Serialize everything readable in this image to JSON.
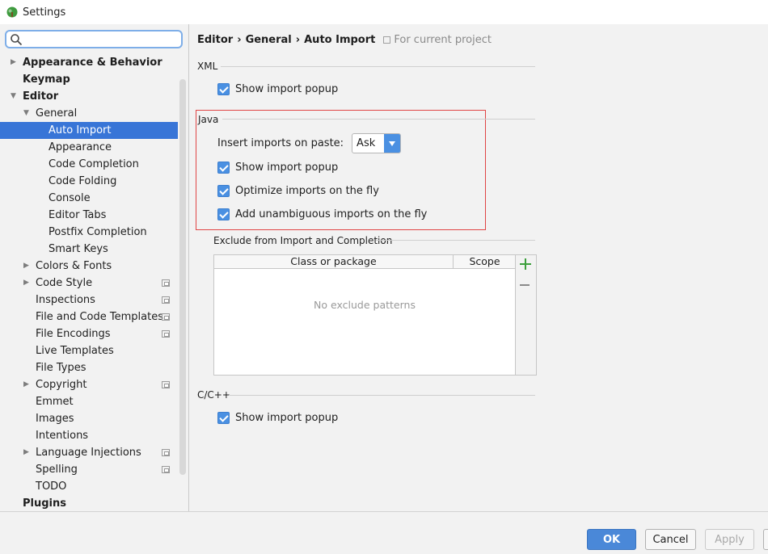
{
  "window": {
    "title": "Settings"
  },
  "search": {
    "placeholder": "",
    "value": ""
  },
  "sidebar": {
    "items": [
      {
        "label": "Appearance & Behavior",
        "level": 0,
        "arrow": "collapsed",
        "bold": true,
        "project": false,
        "selected": false
      },
      {
        "label": "Keymap",
        "level": 0,
        "arrow": "none",
        "bold": true,
        "project": false,
        "selected": false
      },
      {
        "label": "Editor",
        "level": 0,
        "arrow": "expanded",
        "bold": true,
        "project": false,
        "selected": false
      },
      {
        "label": "General",
        "level": 1,
        "arrow": "expanded",
        "bold": false,
        "project": false,
        "selected": false
      },
      {
        "label": "Auto Import",
        "level": 2,
        "arrow": "none",
        "bold": false,
        "project": false,
        "selected": true
      },
      {
        "label": "Appearance",
        "level": 2,
        "arrow": "none",
        "bold": false,
        "project": false,
        "selected": false
      },
      {
        "label": "Code Completion",
        "level": 2,
        "arrow": "none",
        "bold": false,
        "project": false,
        "selected": false
      },
      {
        "label": "Code Folding",
        "level": 2,
        "arrow": "none",
        "bold": false,
        "project": false,
        "selected": false
      },
      {
        "label": "Console",
        "level": 2,
        "arrow": "none",
        "bold": false,
        "project": false,
        "selected": false
      },
      {
        "label": "Editor Tabs",
        "level": 2,
        "arrow": "none",
        "bold": false,
        "project": false,
        "selected": false
      },
      {
        "label": "Postfix Completion",
        "level": 2,
        "arrow": "none",
        "bold": false,
        "project": false,
        "selected": false
      },
      {
        "label": "Smart Keys",
        "level": 2,
        "arrow": "none",
        "bold": false,
        "project": false,
        "selected": false
      },
      {
        "label": "Colors & Fonts",
        "level": 1,
        "arrow": "collapsed",
        "bold": false,
        "project": false,
        "selected": false
      },
      {
        "label": "Code Style",
        "level": 1,
        "arrow": "collapsed",
        "bold": false,
        "project": true,
        "selected": false
      },
      {
        "label": "Inspections",
        "level": 1,
        "arrow": "none",
        "bold": false,
        "project": true,
        "selected": false
      },
      {
        "label": "File and Code Templates",
        "level": 1,
        "arrow": "none",
        "bold": false,
        "project": true,
        "selected": false
      },
      {
        "label": "File Encodings",
        "level": 1,
        "arrow": "none",
        "bold": false,
        "project": true,
        "selected": false
      },
      {
        "label": "Live Templates",
        "level": 1,
        "arrow": "none",
        "bold": false,
        "project": false,
        "selected": false
      },
      {
        "label": "File Types",
        "level": 1,
        "arrow": "none",
        "bold": false,
        "project": false,
        "selected": false
      },
      {
        "label": "Copyright",
        "level": 1,
        "arrow": "collapsed",
        "bold": false,
        "project": true,
        "selected": false
      },
      {
        "label": "Emmet",
        "level": 1,
        "arrow": "none",
        "bold": false,
        "project": false,
        "selected": false
      },
      {
        "label": "Images",
        "level": 1,
        "arrow": "none",
        "bold": false,
        "project": false,
        "selected": false
      },
      {
        "label": "Intentions",
        "level": 1,
        "arrow": "none",
        "bold": false,
        "project": false,
        "selected": false
      },
      {
        "label": "Language Injections",
        "level": 1,
        "arrow": "collapsed",
        "bold": false,
        "project": true,
        "selected": false
      },
      {
        "label": "Spelling",
        "level": 1,
        "arrow": "none",
        "bold": false,
        "project": true,
        "selected": false
      },
      {
        "label": "TODO",
        "level": 1,
        "arrow": "none",
        "bold": false,
        "project": false,
        "selected": false
      },
      {
        "label": "Plugins",
        "level": 0,
        "arrow": "none",
        "bold": true,
        "project": false,
        "selected": false
      }
    ]
  },
  "breadcrumb": {
    "parts": [
      "Editor",
      "General",
      "Auto Import"
    ],
    "separator": "›",
    "scope": "For current project"
  },
  "xml": {
    "title": "XML",
    "show_import_popup": {
      "label": "Show import popup",
      "checked": true
    }
  },
  "java": {
    "title": "Java",
    "insert_imports_label": "Insert imports on paste:",
    "insert_imports_value": "Ask",
    "show_import_popup": {
      "label": "Show import popup",
      "checked": true
    },
    "optimize_imports": {
      "label": "Optimize imports on the fly",
      "checked": true
    },
    "add_unambiguous": {
      "label": "Add unambiguous imports on the fly",
      "checked": true
    }
  },
  "exclude": {
    "title": "Exclude from Import and Completion",
    "columns": [
      "Class or package",
      "Scope"
    ],
    "empty_text": "No exclude patterns"
  },
  "cpp": {
    "title": "C/C++",
    "show_import_popup": {
      "label": "Show import popup",
      "checked": true
    }
  },
  "footer": {
    "ok": "OK",
    "cancel": "Cancel",
    "apply": "Apply",
    "help": ""
  },
  "colors": {
    "accent": "#3875d7",
    "checkbox": "#4a90e2",
    "highlight": "#e04545",
    "add": "#3c9f3c"
  }
}
